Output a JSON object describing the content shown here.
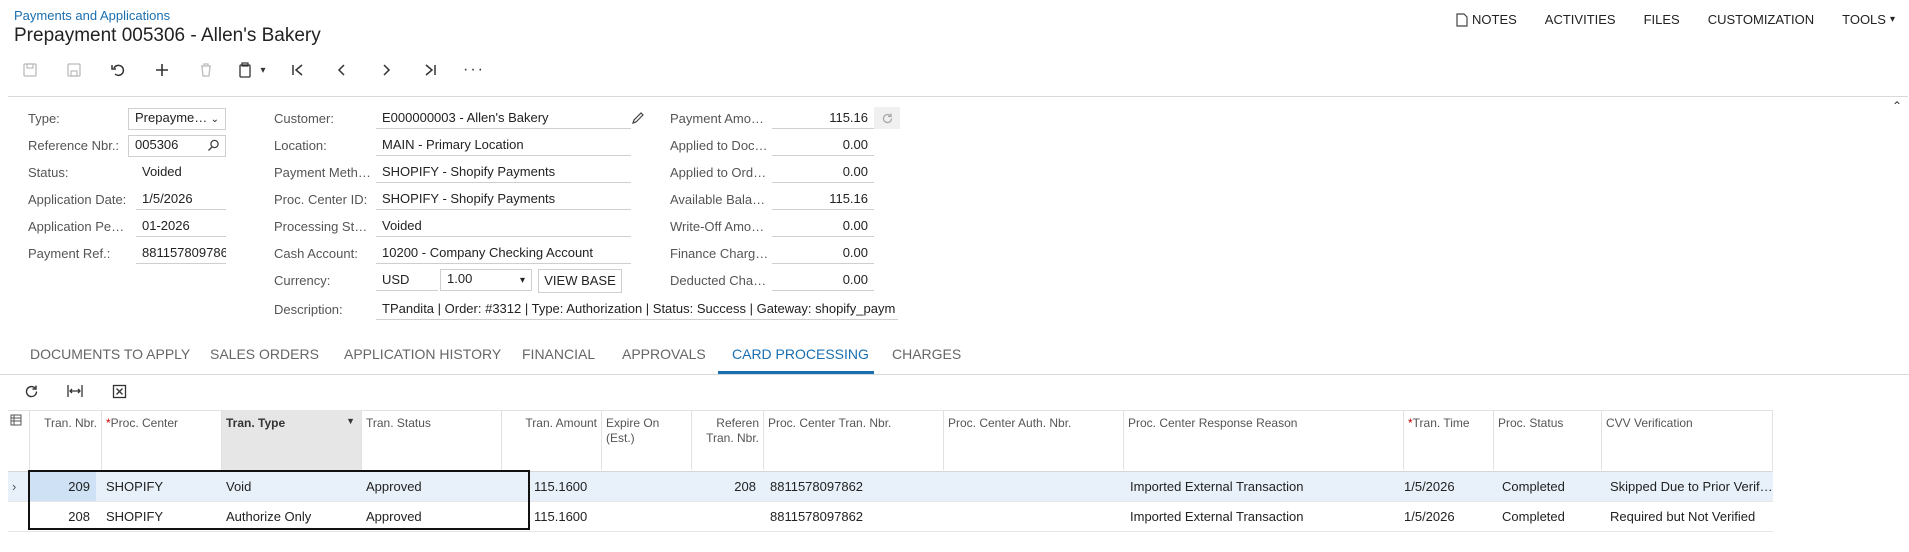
{
  "header": {
    "breadcrumb": "Payments and Applications",
    "title": "Prepayment 005306 - Allen's Bakery",
    "nav": [
      "NOTES",
      "ACTIVITIES",
      "FILES",
      "CUSTOMIZATION",
      "TOOLS"
    ]
  },
  "form": {
    "type_label": "Type:",
    "type_value": "Prepayme…",
    "refnbr_label": "Reference Nbr.:",
    "refnbr_value": "005306",
    "status_label": "Status:",
    "status_value": "Voided",
    "appdate_label": "Application Date:",
    "appdate_value": "1/5/2026",
    "appperiod_label": "Application Pe…",
    "appperiod_value": "01-2026",
    "payref_label": "Payment Ref.:",
    "payref_value": "881157809786",
    "customer_label": "Customer:",
    "customer_value": "E000000003 - Allen's Bakery",
    "location_label": "Location:",
    "location_value": "MAIN - Primary Location",
    "paymeth_label": "Payment Meth…",
    "paymeth_value": "SHOPIFY - Shopify Payments",
    "proccenter_label": "Proc. Center ID:",
    "proccenter_value": "SHOPIFY - Shopify Payments",
    "procstatus_label": "Processing St…",
    "procstatus_value": "Voided",
    "cashacct_label": "Cash Account:",
    "cashacct_value": "10200 - Company Checking Account",
    "currency_label": "Currency:",
    "currency_value": "USD",
    "rate_value": "1.00",
    "viewbase_label": "VIEW BASE",
    "desc_label": "Description:",
    "desc_value": "TPandita | Order: #3312 | Type: Authorization | Status: Success | Gateway: shopify_paym",
    "payamt_label": "Payment Amo…",
    "payamt_value": "115.16",
    "appdoc_label": "Applied to Doc…",
    "appdoc_value": "0.00",
    "appord_label": "Applied to Ord…",
    "appord_value": "0.00",
    "avail_label": "Available Bala…",
    "avail_value": "115.16",
    "writeoff_label": "Write-Off Amo…",
    "writeoff_value": "0.00",
    "fincharge_label": "Finance Charg…",
    "fincharge_value": "0.00",
    "deducted_label": "Deducted Cha…",
    "deducted_value": "0.00"
  },
  "tabs": [
    "DOCUMENTS TO APPLY",
    "SALES ORDERS",
    "APPLICATION HISTORY",
    "FINANCIAL",
    "APPROVALS",
    "CARD PROCESSING",
    "CHARGES"
  ],
  "grid": {
    "headers": {
      "tran_nbr": "Tran. Nbr.",
      "proc_center": "Proc. Center",
      "tran_type": "Tran. Type",
      "tran_status": "Tran. Status",
      "tran_amount": "Tran. Amount",
      "expire_on": "Expire On (Est.)",
      "ref_tran_nbr": "Referen Tran. Nbr.",
      "pc_tran_nbr": "Proc. Center Tran. Nbr.",
      "pc_auth_nbr": "Proc. Center Auth. Nbr.",
      "pc_reason": "Proc. Center Response Reason",
      "tran_time": "Tran. Time",
      "proc_status": "Proc. Status",
      "cvv": "CVV Verification"
    },
    "rows": [
      {
        "tran_nbr": "209",
        "proc_center": "SHOPIFY",
        "tran_type": "Void",
        "tran_status": "Approved",
        "tran_amount": "115.1600",
        "expire_on": "",
        "ref_tran_nbr": "208",
        "pc_tran_nbr": "8811578097862",
        "pc_auth_nbr": "",
        "pc_reason": "Imported External Transaction",
        "tran_time": "1/5/2026",
        "proc_status": "Completed",
        "cvv": "Skipped Due to Prior Verif…"
      },
      {
        "tran_nbr": "208",
        "proc_center": "SHOPIFY",
        "tran_type": "Authorize Only",
        "tran_status": "Approved",
        "tran_amount": "115.1600",
        "expire_on": "",
        "ref_tran_nbr": "",
        "pc_tran_nbr": "8811578097862",
        "pc_auth_nbr": "",
        "pc_reason": "Imported External Transaction",
        "tran_time": "1/5/2026",
        "proc_status": "Completed",
        "cvv": "Required but Not Verified"
      }
    ]
  }
}
